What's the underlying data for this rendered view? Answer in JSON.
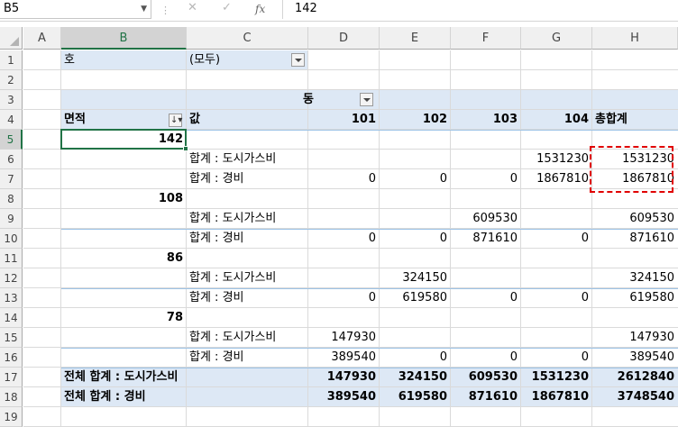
{
  "name_box": "B5",
  "formula_value": "142",
  "formula_icons": [
    "cancel-icon",
    "enter-icon",
    "function-icon"
  ],
  "columns": [
    "A",
    "B",
    "C",
    "D",
    "E",
    "F",
    "G",
    "H"
  ],
  "rows": [
    "1",
    "2",
    "3",
    "4",
    "5",
    "6",
    "7",
    "8",
    "9",
    "10",
    "11",
    "12",
    "13",
    "14",
    "15",
    "16",
    "17",
    "18",
    "19"
  ],
  "selected_column": "B",
  "selected_row": "5",
  "pivot": {
    "filter_label": "호",
    "filter_value": "(모두)",
    "column_field": "동",
    "row_field": "면적",
    "values_label": "값",
    "column_items": [
      "101",
      "102",
      "103",
      "104"
    ],
    "grand_total_header": "총합계",
    "groups": [
      {
        "area": "142",
        "lines": [
          {
            "label": "합계 : 도시가스비",
            "values": [
              "",
              "",
              "",
              "1531230"
            ],
            "total": "1531230"
          },
          {
            "label": "합계 : 경비",
            "values": [
              "0",
              "0",
              "0",
              "1867810"
            ],
            "total": "1867810"
          }
        ]
      },
      {
        "area": "108",
        "lines": [
          {
            "label": "합계 : 도시가스비",
            "values": [
              "",
              "",
              "609530",
              ""
            ],
            "total": "609530"
          },
          {
            "label": "합계 : 경비",
            "values": [
              "0",
              "0",
              "871610",
              "0"
            ],
            "total": "871610"
          }
        ]
      },
      {
        "area": "86",
        "lines": [
          {
            "label": "합계 : 도시가스비",
            "values": [
              "",
              "324150",
              "",
              ""
            ],
            "total": "324150"
          },
          {
            "label": "합계 : 경비",
            "values": [
              "0",
              "619580",
              "0",
              "0"
            ],
            "total": "619580"
          }
        ]
      },
      {
        "area": "78",
        "lines": [
          {
            "label": "합계 : 도시가스비",
            "values": [
              "147930",
              "",
              "",
              ""
            ],
            "total": "147930"
          },
          {
            "label": "합계 : 경비",
            "values": [
              "389540",
              "0",
              "0",
              "0"
            ],
            "total": "389540"
          }
        ]
      }
    ],
    "grand_totals": [
      {
        "label": "전체 합계 : 도시가스비",
        "values": [
          "147930",
          "324150",
          "609530",
          "1531230"
        ],
        "total": "2612840"
      },
      {
        "label": "전체 합계 : 경비",
        "values": [
          "389540",
          "619580",
          "871610",
          "1867810"
        ],
        "total": "3748540"
      }
    ]
  },
  "colors": {
    "header_band": "#dde8f5",
    "excel_green": "#217346",
    "highlight_red": "#e00000"
  }
}
